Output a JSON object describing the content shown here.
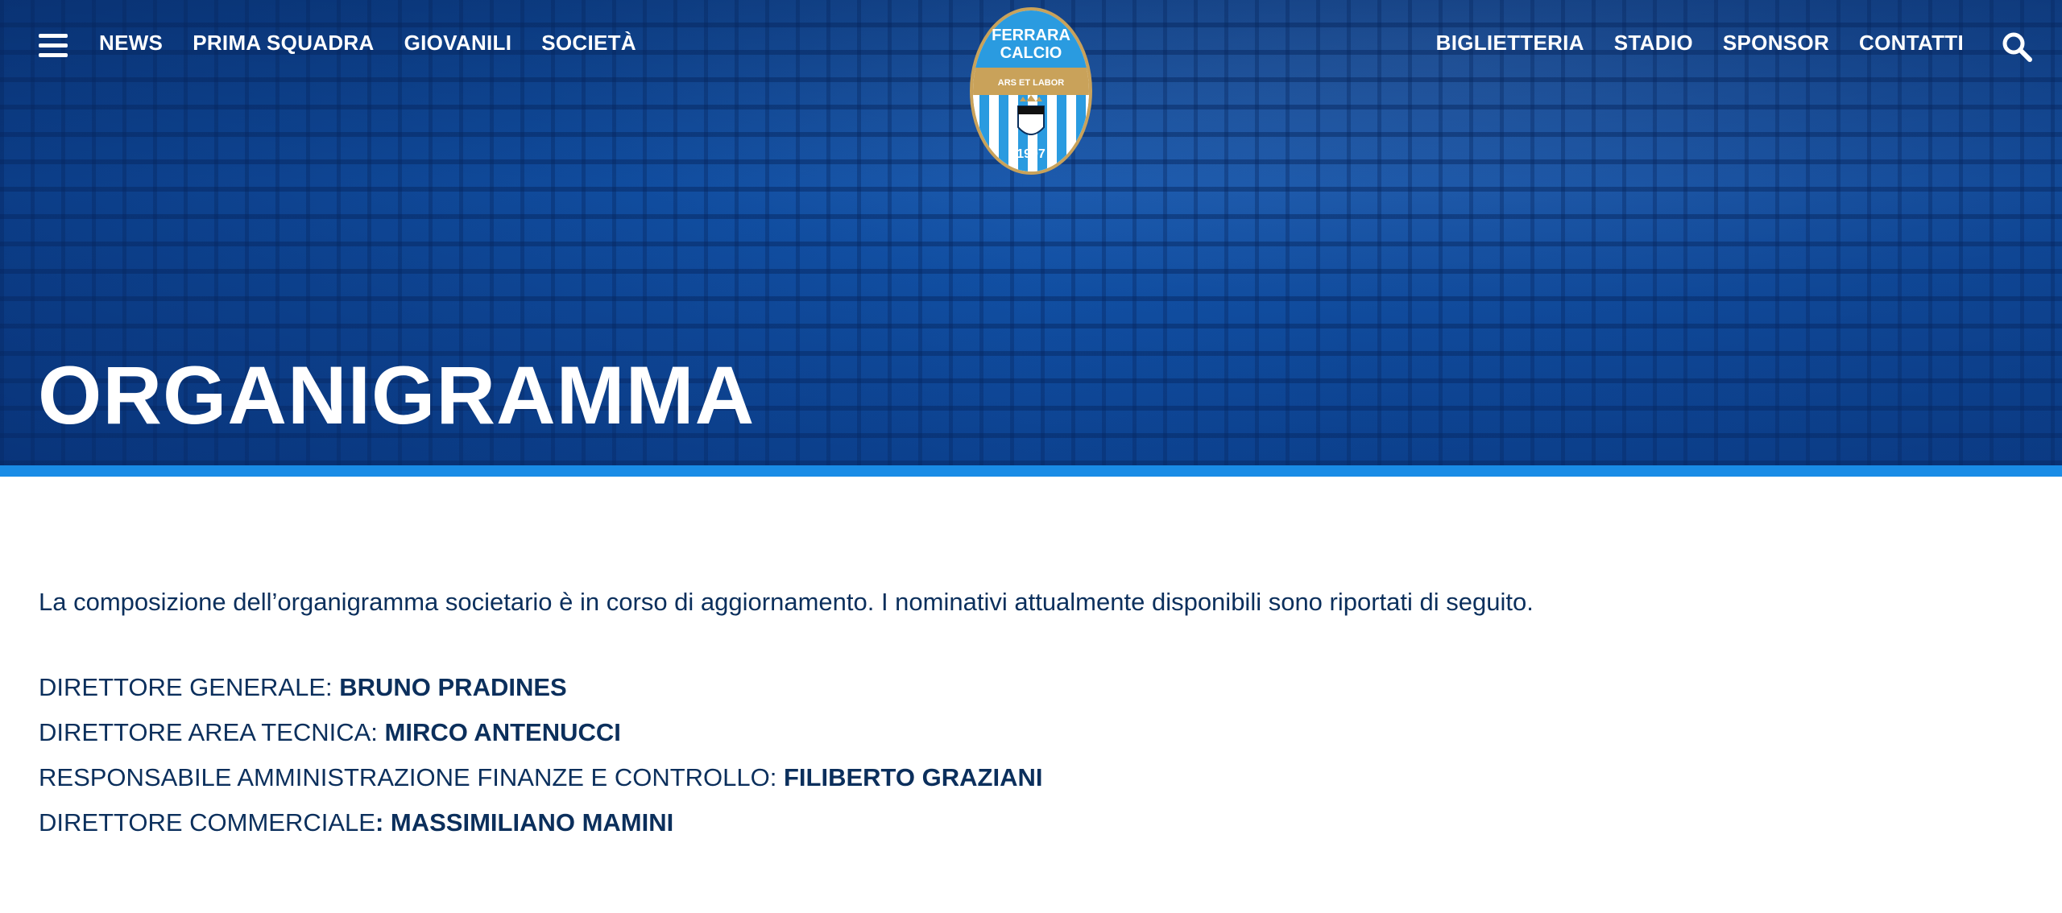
{
  "nav": {
    "left": [
      {
        "label": "NEWS"
      },
      {
        "label": "PRIMA SQUADRA"
      },
      {
        "label": "GIOVANILI"
      },
      {
        "label": "SOCIETÀ"
      }
    ],
    "right": [
      {
        "label": "BIGLIETTERIA"
      },
      {
        "label": "STADIO"
      },
      {
        "label": "SPONSOR"
      },
      {
        "label": "CONTATTI"
      }
    ]
  },
  "logo": {
    "line1": "FERRARA",
    "line2": "CALCIO",
    "motto": "ARS ET LABOR",
    "year": "1907"
  },
  "page": {
    "title": "ORGANIGRAMMA"
  },
  "content": {
    "intro": "La composizione dell’organigramma societario è in corso di aggiornamento. I nominativi attualmente disponibili sono riportati di seguito.",
    "roles": [
      {
        "role": "DIRETTORE GENERALE: ",
        "name": "BRUNO PRADINES"
      },
      {
        "role": "DIRETTORE AREA TECNICA: ",
        "name": "MIRCO ANTENUCCI"
      },
      {
        "role": "RESPONSABILE AMMINISTRAZIONE FINANZE E CONTROLLO: ",
        "name": "FILIBERTO GRAZIANI"
      },
      {
        "role": "DIRETTORE COMMERCIALE",
        "name": ": MASSIMILIANO MAMINI"
      }
    ]
  },
  "colors": {
    "hero": "#0c4fa0",
    "accent_bar": "#1a8ce6",
    "text": "#0b2f5c",
    "logo_gold": "#c9a25a",
    "logo_blue": "#2a9be0"
  },
  "icons": {
    "menu": "hamburger-menu-icon",
    "search": "search-icon"
  }
}
